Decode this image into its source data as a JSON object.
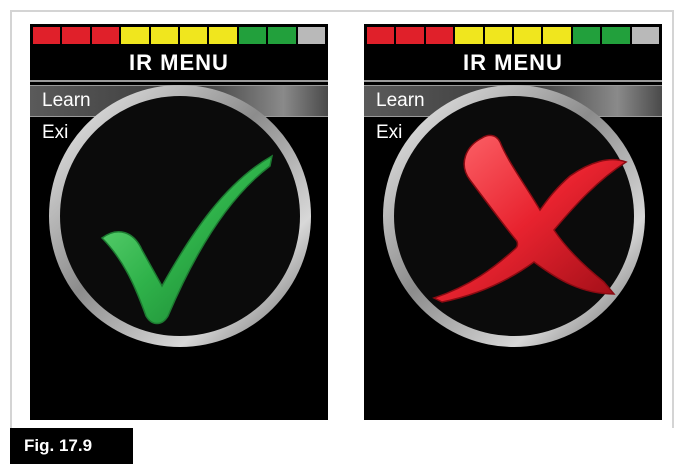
{
  "figure": {
    "label": "Fig. 17.9"
  },
  "battery_colors": [
    "#e0202a",
    "#e0202a",
    "#e0202a",
    "#f0e61e",
    "#f0e61e",
    "#f0e61e",
    "#f0e61e",
    "#22a03c",
    "#22a03c",
    "#b9b9b9"
  ],
  "screens": [
    {
      "title": "IR MENU",
      "items": [
        "Learn",
        "Exi"
      ],
      "overlay_icon": "check-mark-icon",
      "overlay_color": "#2fb24a"
    },
    {
      "title": "IR MENU",
      "items": [
        "Learn",
        "Exi"
      ],
      "overlay_icon": "cross-mark-icon",
      "overlay_color": "#e8232f"
    }
  ]
}
